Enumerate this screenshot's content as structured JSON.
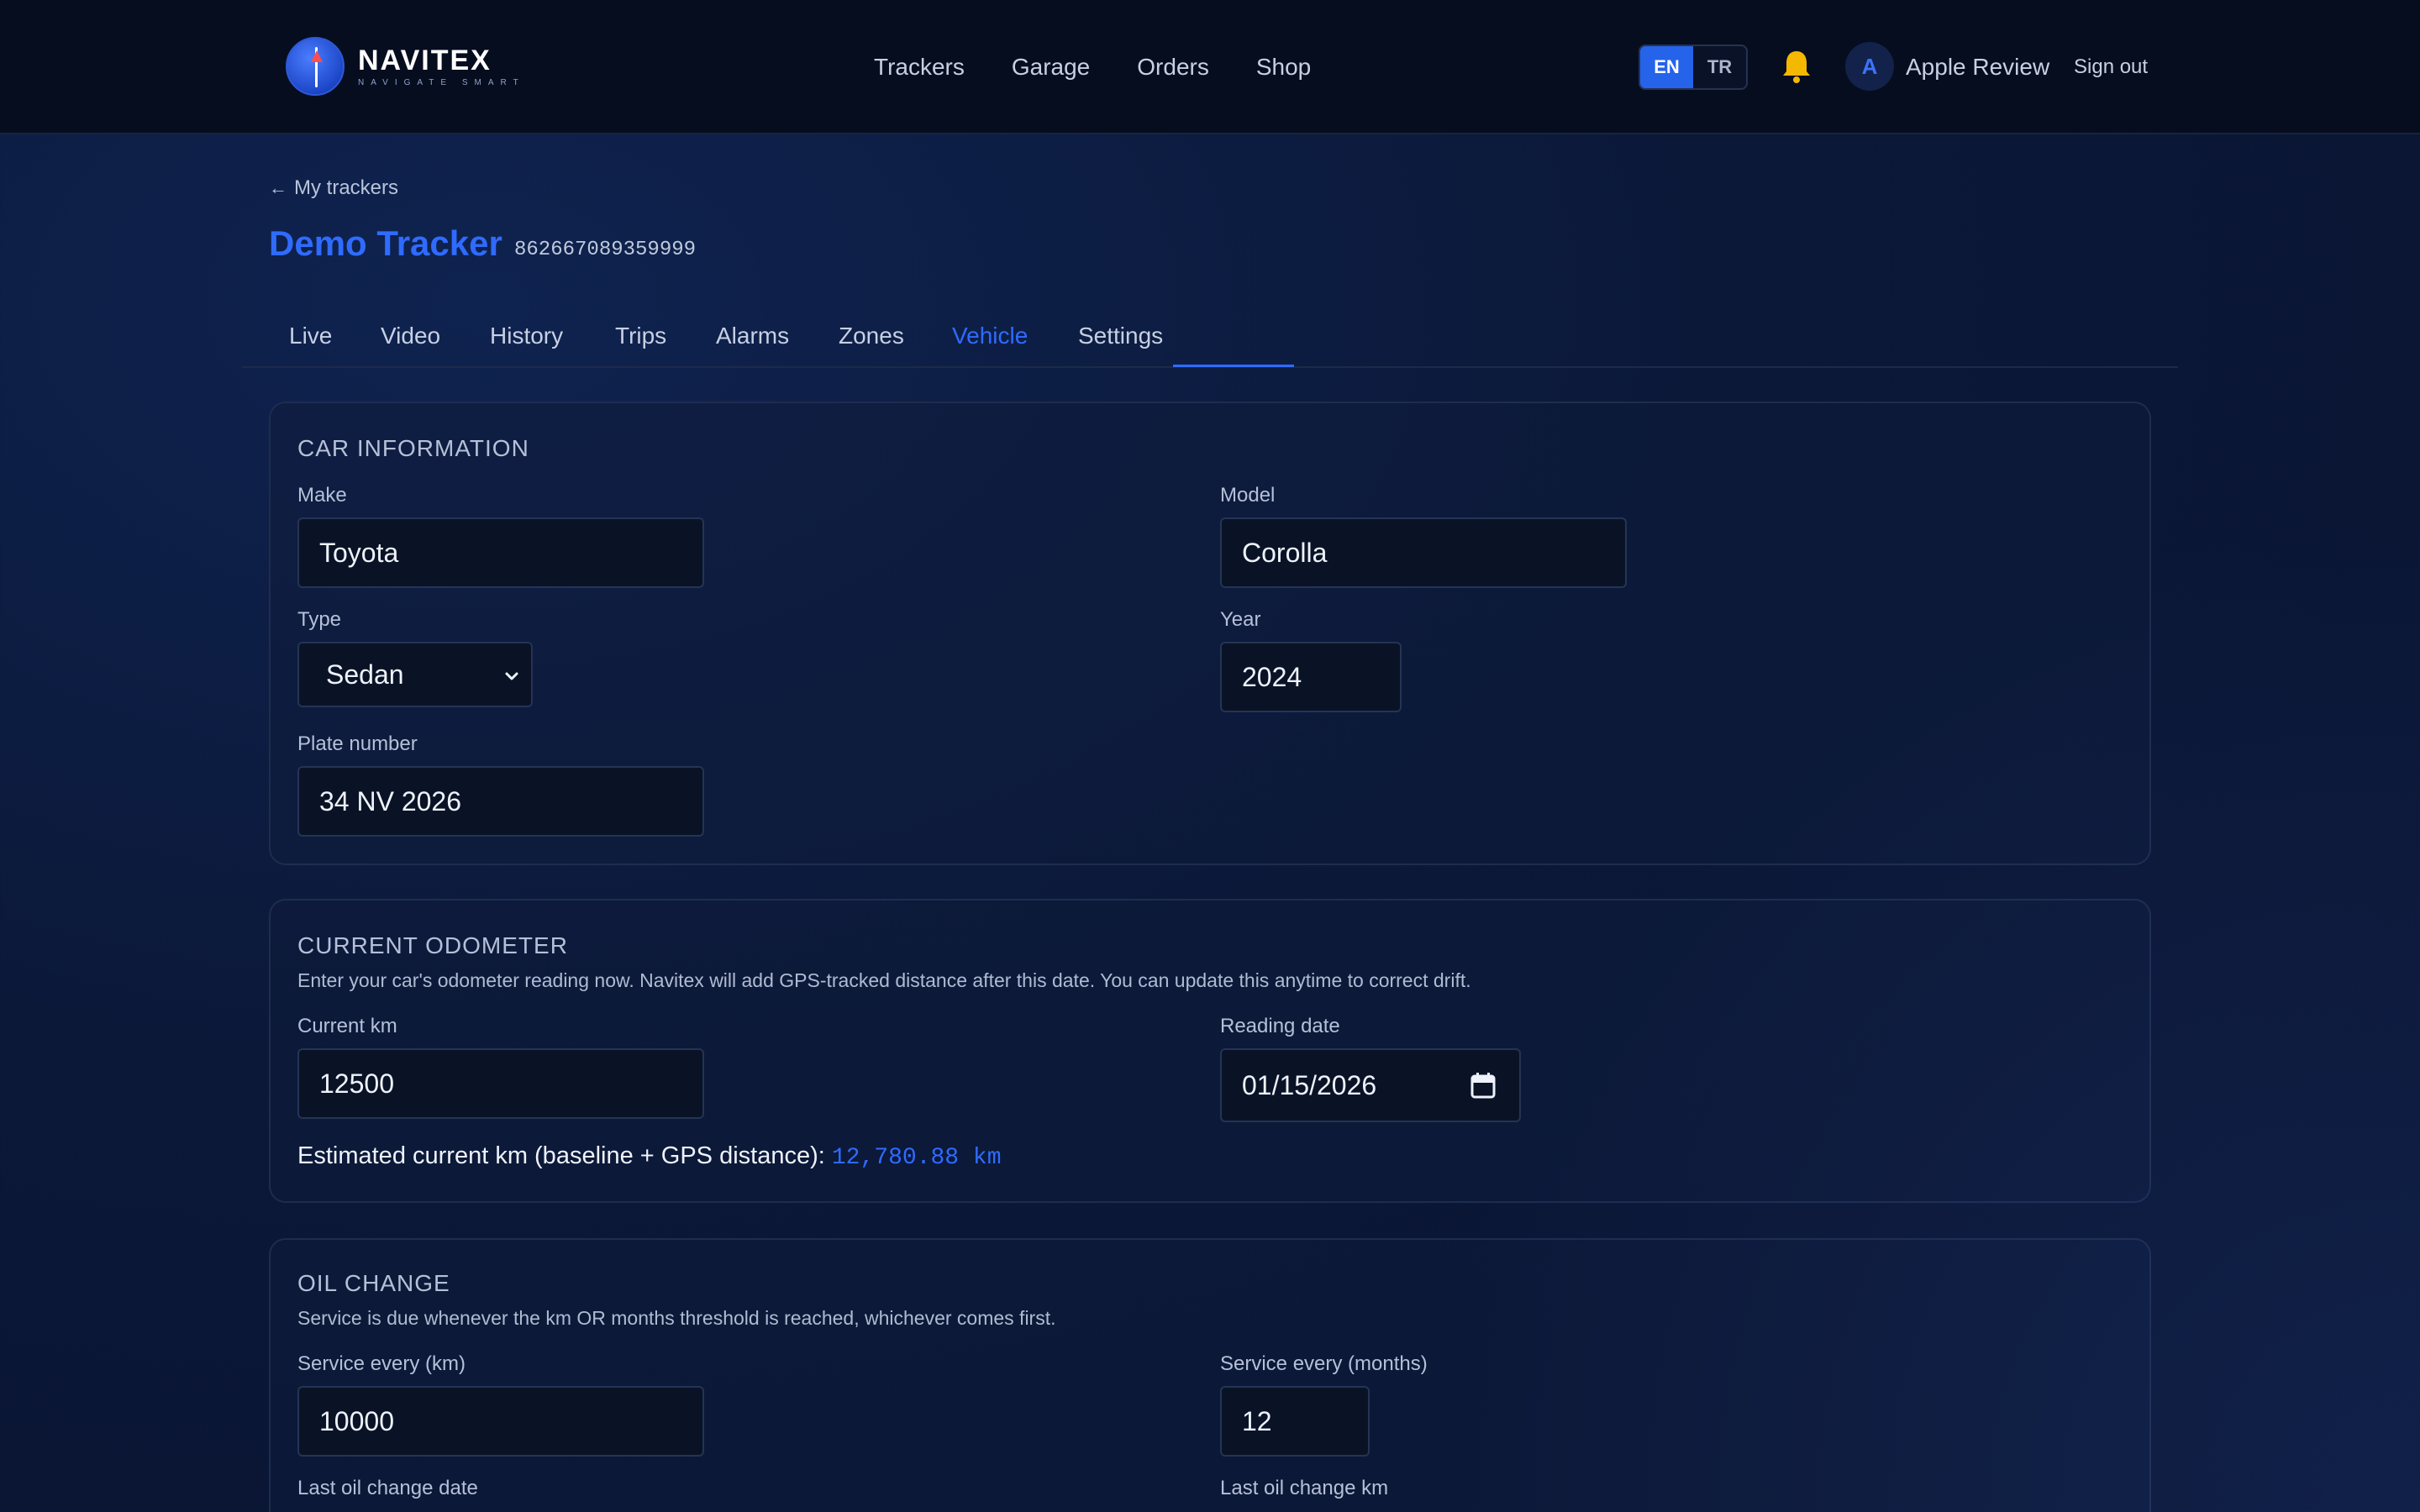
{
  "header": {
    "brand_name": "NAVITEX",
    "brand_tagline": "NAVIGATE SMART",
    "nav": [
      "Trackers",
      "Garage",
      "Orders",
      "Shop"
    ],
    "lang_active": "EN",
    "lang_other": "TR",
    "avatar_initial": "A",
    "user_name": "Apple Review",
    "signout_label": "Sign out"
  },
  "page": {
    "back_label": "My trackers",
    "title": "Demo Tracker",
    "imei": "862667089359999",
    "tabs": [
      "Live",
      "Video",
      "History",
      "Trips",
      "Alarms",
      "Zones",
      "Vehicle",
      "Settings"
    ],
    "active_tab": "Vehicle"
  },
  "car_info": {
    "title": "CAR INFORMATION",
    "make_label": "Make",
    "make_value": "Toyota",
    "model_label": "Model",
    "model_value": "Corolla",
    "type_label": "Type",
    "type_value": "Sedan",
    "year_label": "Year",
    "year_value": "2024",
    "plate_label": "Plate number",
    "plate_value": "34 NV 2026"
  },
  "odometer": {
    "title": "CURRENT ODOMETER",
    "description": "Enter your car's odometer reading now. Navitex will add GPS-tracked distance after this date. You can update this anytime to correct drift.",
    "current_km_label": "Current km",
    "current_km_value": "12500",
    "reading_date_label": "Reading date",
    "reading_date_value": "01/15/2026",
    "estimate_label": "Estimated current km (baseline + GPS distance):",
    "estimate_value": "12,780.88 km"
  },
  "oil_change": {
    "title": "OIL CHANGE",
    "description": "Service is due whenever the km OR months threshold is reached, whichever comes first.",
    "service_km_label": "Service every (km)",
    "service_km_value": "10000",
    "service_months_label": "Service every (months)",
    "service_months_value": "12",
    "last_date_label": "Last oil change date",
    "last_km_label": "Last oil change km"
  },
  "colors": {
    "accent": "#2f6bff",
    "header_bg": "#060d1f",
    "page_bg": "#0b1838",
    "bell": "#f5b800"
  }
}
